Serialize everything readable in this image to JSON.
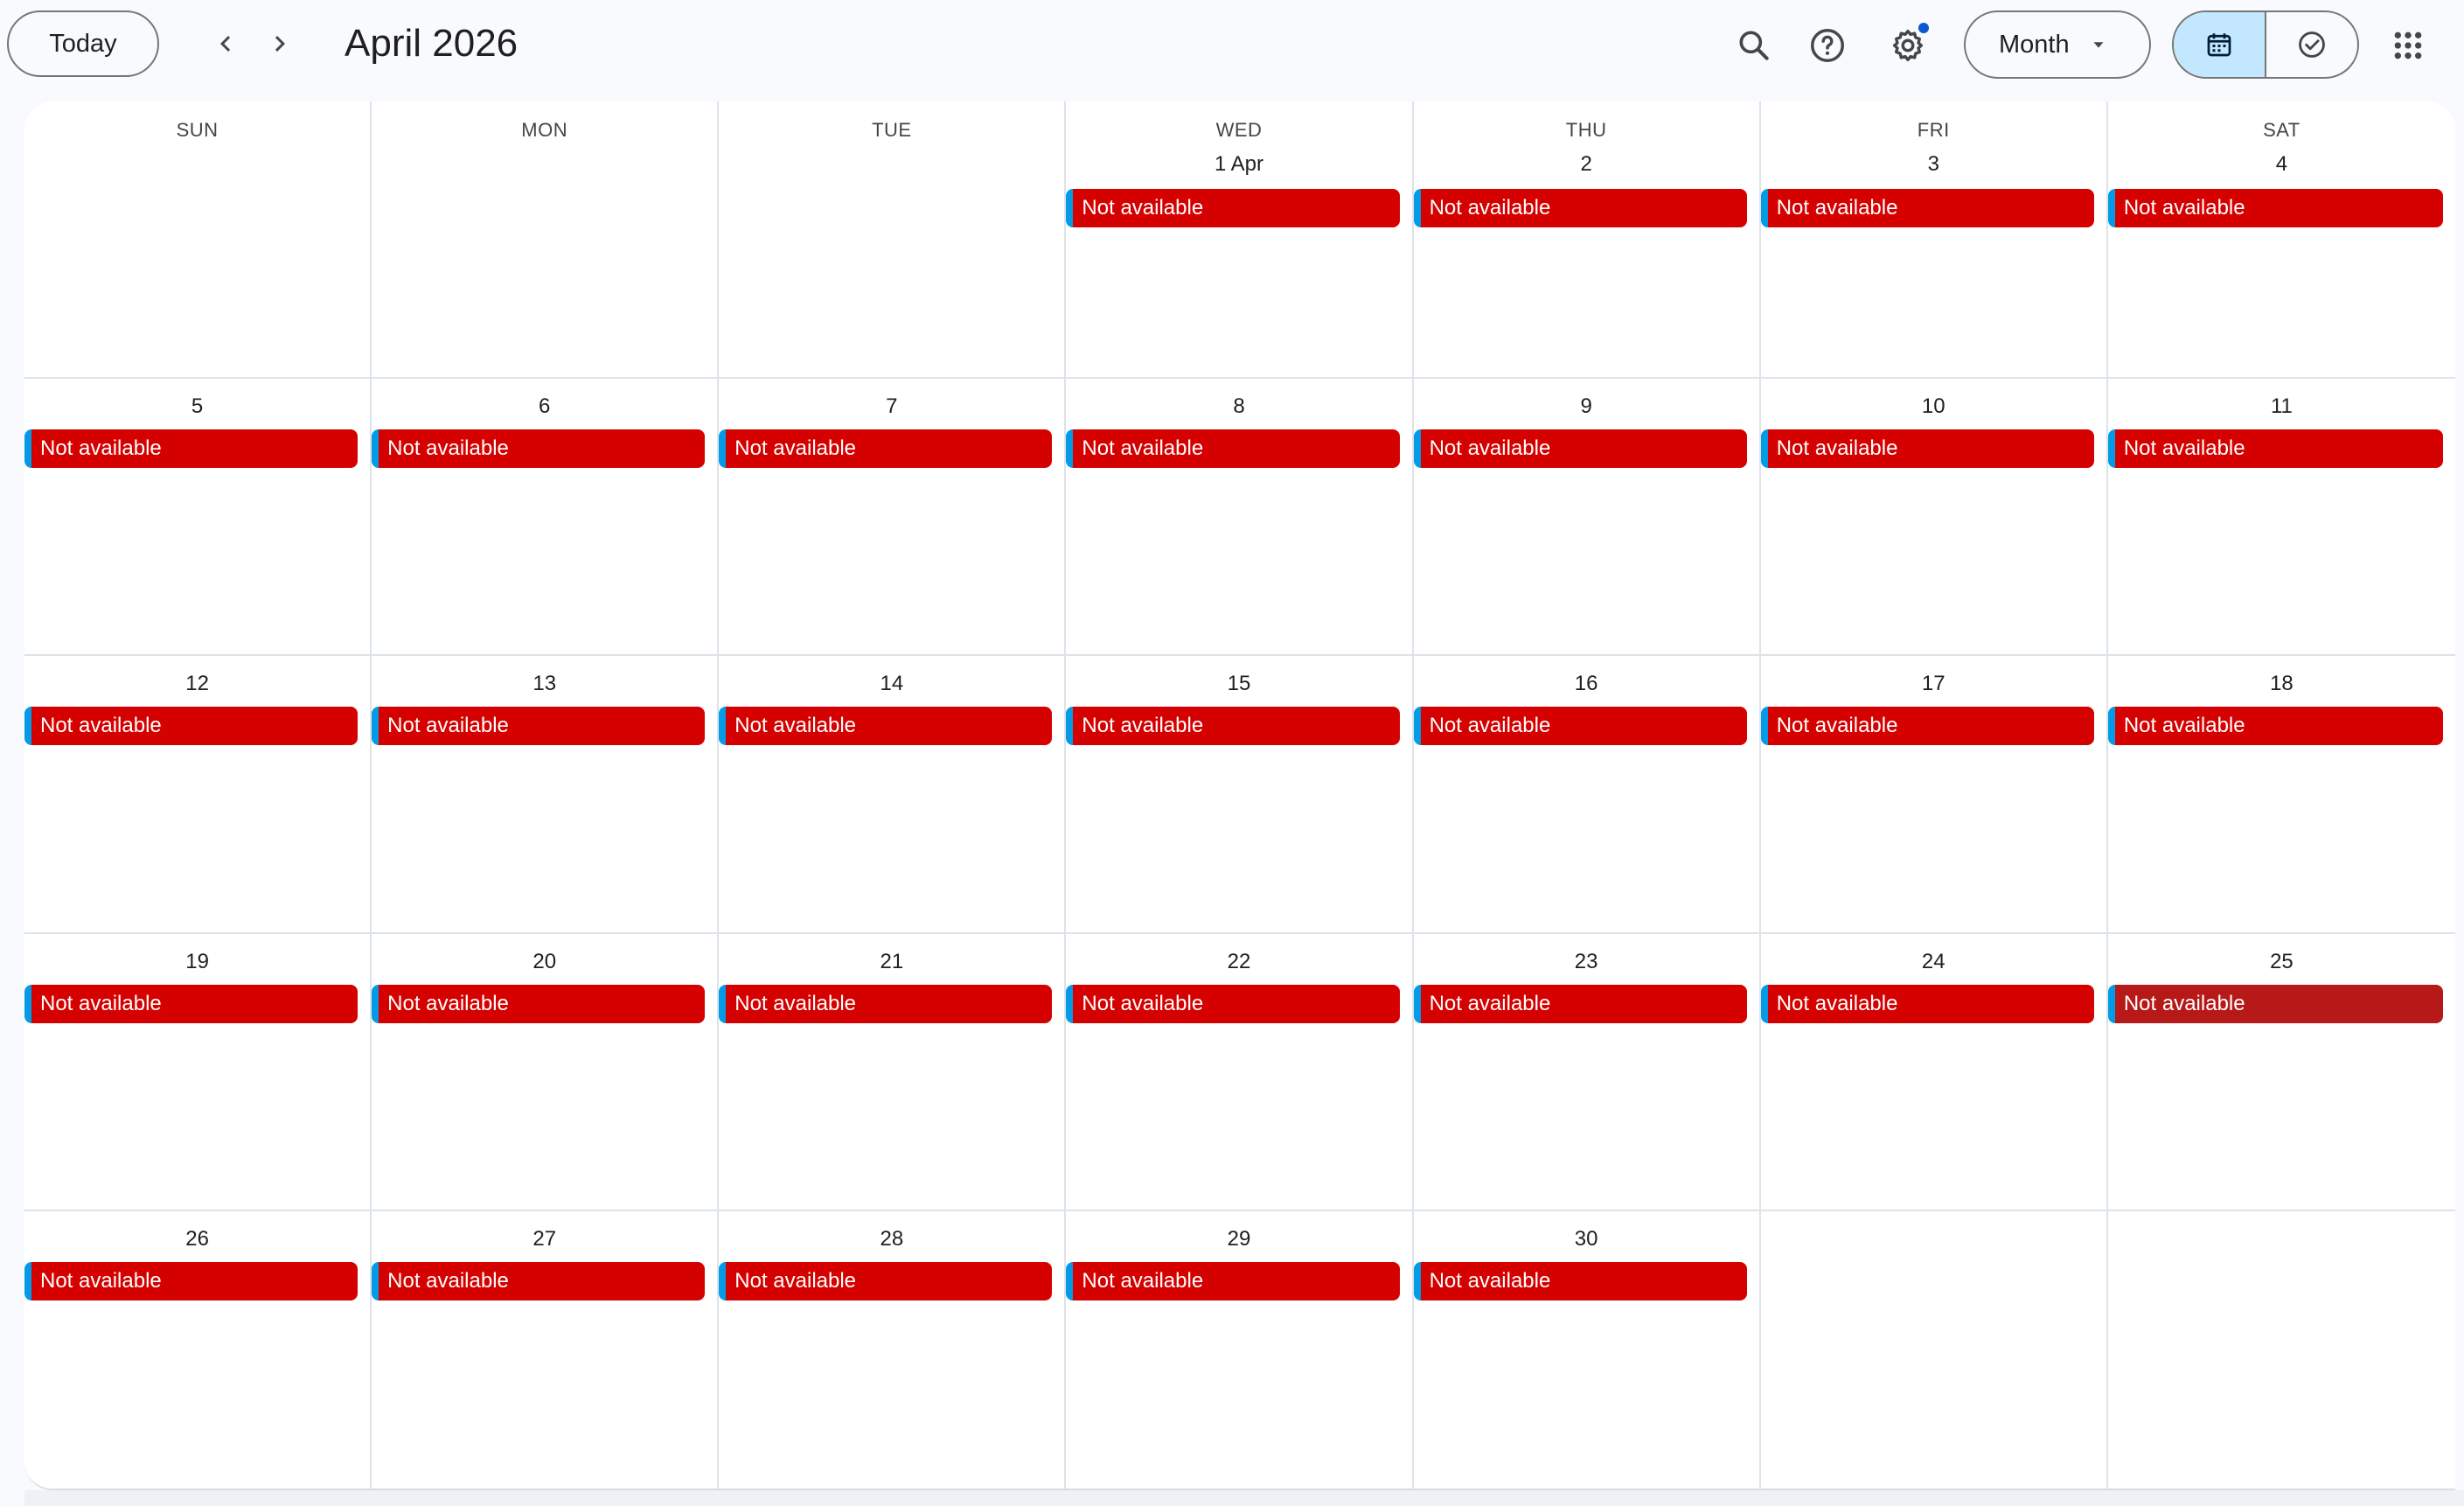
{
  "toolbar": {
    "today_label": "Today",
    "title": "April 2026",
    "view_label": "Month"
  },
  "icons": {
    "prev": "chevron-left-icon",
    "next": "chevron-right-icon",
    "search": "search-icon",
    "help": "help-icon",
    "settings": "gear-icon",
    "dropdown": "caret-down-icon",
    "calendar_view": "calendar-icon",
    "tasks_view": "check-circle-icon",
    "apps": "apps-grid-icon"
  },
  "colors": {
    "event_bg": "#d50000",
    "event_bg_hover": "#b71818",
    "event_accent": "#039be5",
    "active_segment": "#c2e7ff",
    "notification_dot": "#0b57d0"
  },
  "weekdays": [
    "SUN",
    "MON",
    "TUE",
    "WED",
    "THU",
    "FRI",
    "SAT"
  ],
  "weeks": [
    [
      {
        "day": "",
        "event": ""
      },
      {
        "day": "",
        "event": ""
      },
      {
        "day": "",
        "event": ""
      },
      {
        "day": "1 Apr",
        "event": "Not available"
      },
      {
        "day": "2",
        "event": "Not available"
      },
      {
        "day": "3",
        "event": "Not available"
      },
      {
        "day": "4",
        "event": "Not available"
      }
    ],
    [
      {
        "day": "5",
        "event": "Not available"
      },
      {
        "day": "6",
        "event": "Not available"
      },
      {
        "day": "7",
        "event": "Not available"
      },
      {
        "day": "8",
        "event": "Not available"
      },
      {
        "day": "9",
        "event": "Not available"
      },
      {
        "day": "10",
        "event": "Not available"
      },
      {
        "day": "11",
        "event": "Not available"
      }
    ],
    [
      {
        "day": "12",
        "event": "Not available"
      },
      {
        "day": "13",
        "event": "Not available"
      },
      {
        "day": "14",
        "event": "Not available"
      },
      {
        "day": "15",
        "event": "Not available"
      },
      {
        "day": "16",
        "event": "Not available"
      },
      {
        "day": "17",
        "event": "Not available"
      },
      {
        "day": "18",
        "event": "Not available"
      }
    ],
    [
      {
        "day": "19",
        "event": "Not available"
      },
      {
        "day": "20",
        "event": "Not available"
      },
      {
        "day": "21",
        "event": "Not available"
      },
      {
        "day": "22",
        "event": "Not available"
      },
      {
        "day": "23",
        "event": "Not available"
      },
      {
        "day": "24",
        "event": "Not available"
      },
      {
        "day": "25",
        "event": "Not available",
        "hover": true
      }
    ],
    [
      {
        "day": "26",
        "event": "Not available"
      },
      {
        "day": "27",
        "event": "Not available"
      },
      {
        "day": "28",
        "event": "Not available"
      },
      {
        "day": "29",
        "event": "Not available"
      },
      {
        "day": "30",
        "event": "Not available"
      },
      {
        "day": "",
        "event": ""
      },
      {
        "day": "",
        "event": ""
      }
    ]
  ]
}
